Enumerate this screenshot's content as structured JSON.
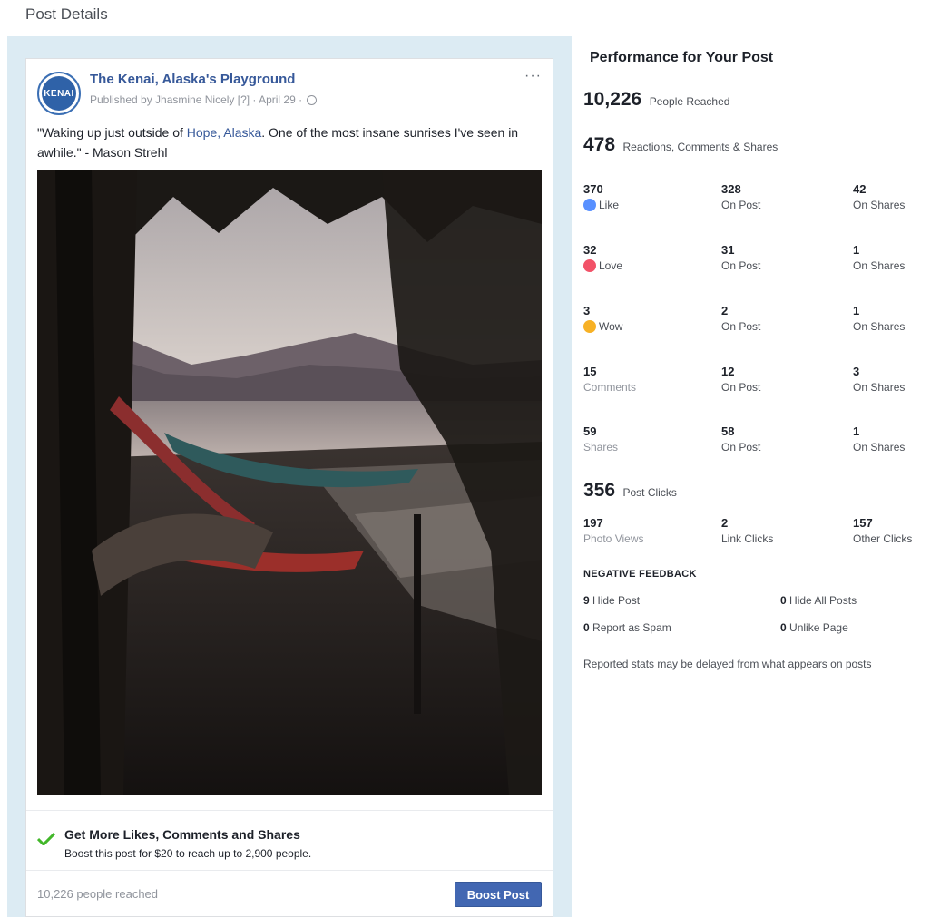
{
  "page": {
    "title": "Post Details"
  },
  "post": {
    "page_name": "The Kenai, Alaska's Playground",
    "avatar_text": "KENAI",
    "published_by": "Published by Jhasmine Nicely [?] · April 29 ·",
    "text_before_link": "\"Waking up just outside of ",
    "link_text": "Hope, Alaska",
    "text_after_link": ". One of the most insane sunrises I've seen in awhile.\" - Mason Strehl",
    "more_icon": "···",
    "boost_headline": "Get More Likes, Comments and Shares",
    "boost_sub": "Boost this post for $20 to reach up to 2,900 people.",
    "reached_footer": "10,226 people reached",
    "boost_button": "Boost Post"
  },
  "performance": {
    "title": "Performance for Your Post",
    "reached": {
      "value": "10,226",
      "label": "People Reached"
    },
    "engagement": {
      "value": "478",
      "label": "Reactions, Comments & Shares"
    },
    "rows": [
      {
        "total": "370",
        "label": "Like",
        "icon": "like-icon",
        "on_post": "328",
        "on_post_label": "On Post",
        "on_shares": "42",
        "on_shares_label": "On Shares"
      },
      {
        "total": "32",
        "label": "Love",
        "icon": "love-icon",
        "on_post": "31",
        "on_post_label": "On Post",
        "on_shares": "1",
        "on_shares_label": "On Shares"
      },
      {
        "total": "3",
        "label": "Wow",
        "icon": "wow-icon",
        "on_post": "2",
        "on_post_label": "On Post",
        "on_shares": "1",
        "on_shares_label": "On Shares"
      },
      {
        "total": "15",
        "label": "Comments",
        "icon": "",
        "on_post": "12",
        "on_post_label": "On Post",
        "on_shares": "3",
        "on_shares_label": "On Shares"
      },
      {
        "total": "59",
        "label": "Shares",
        "icon": "",
        "on_post": "58",
        "on_post_label": "On Post",
        "on_shares": "1",
        "on_shares_label": "On Shares"
      }
    ],
    "clicks": {
      "value": "356",
      "label": "Post Clicks"
    },
    "click_rows": [
      {
        "value": "197",
        "label": "Photo Views"
      },
      {
        "value": "2",
        "label": "Link Clicks"
      },
      {
        "value": "157",
        "label": "Other Clicks"
      }
    ],
    "negative": {
      "title": "NEGATIVE FEEDBACK",
      "items": [
        {
          "value": "9",
          "label": "Hide Post"
        },
        {
          "value": "0",
          "label": "Hide All Posts"
        },
        {
          "value": "0",
          "label": "Report as Spam"
        },
        {
          "value": "0",
          "label": "Unlike Page"
        }
      ]
    },
    "note": "Reported stats may be delayed from what appears on posts"
  },
  "colors": {
    "brand_blue": "#4267b2",
    "link_blue": "#365899",
    "like": "#5890ff",
    "love": "#f25268",
    "wow": "#f7b125",
    "check_green": "#42b72a"
  }
}
